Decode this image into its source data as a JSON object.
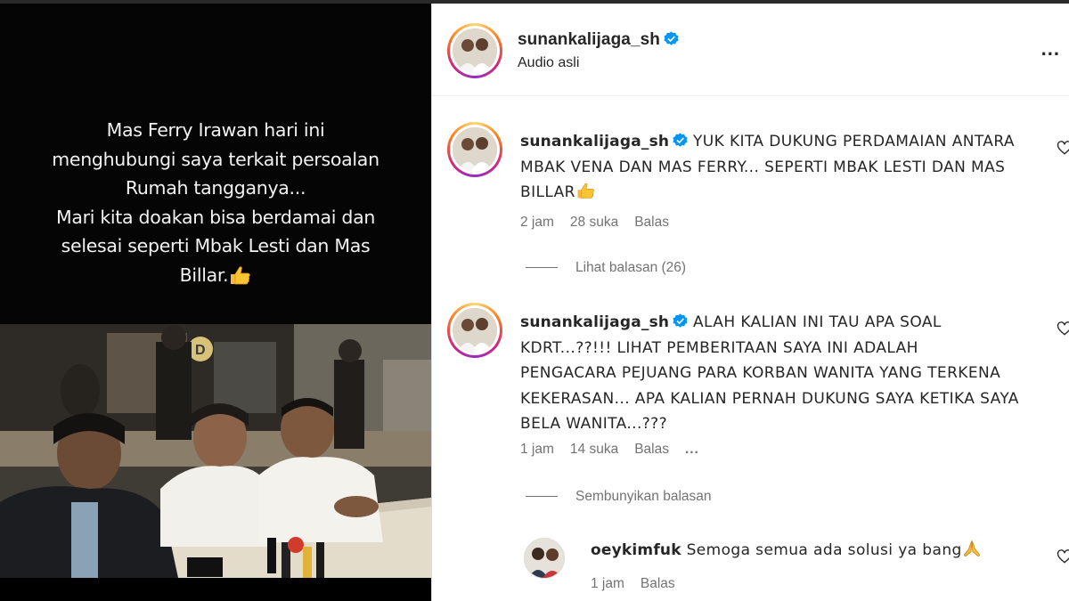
{
  "video": {
    "caption_lines": [
      "Mas Ferry Irawan hari ini",
      "menghubungi saya terkait persoalan",
      "Rumah tangganya...",
      "Mari kita doakan bisa berdamai dan",
      "selesai seperti Mbak Lesti dan Mas",
      "Billar."
    ]
  },
  "post": {
    "username": "sunankalijaga_sh",
    "subtitle": "Audio asli",
    "more": "..."
  },
  "comments": [
    {
      "username": "sunankalijaga_sh",
      "text": "YUK KITA DUKUNG PERDAMAIAN ANTARA MBAK VENA DAN MAS FERRY... SEPERTI MBAK LESTI DAN MAS BILLAR",
      "time": "2 jam",
      "likes": "28 suka",
      "reply": "Balas",
      "replies_toggle": "Lihat balasan (26)"
    },
    {
      "username": "sunankalijaga_sh",
      "text": "ALAH KALIAN INI TAU APA SOAL KDRT...??!!! LIHAT PEMBERITAAN SAYA INI ADALAH PENGACARA PEJUANG PARA KORBAN WANITA YANG TERKENA KEKERASAN... APA KALIAN PERNAH DUKUNG SAYA KETIKA SAYA BELA WANITA...???",
      "time": "1 jam",
      "likes": "14 suka",
      "reply": "Balas",
      "more": "...",
      "replies_toggle": "Sembunyikan balasan"
    }
  ],
  "reply": {
    "username": "oeykimfuk",
    "text": "Semoga semua ada solusi ya bang",
    "time": "1 jam",
    "reply": "Balas"
  },
  "icons": {
    "verified": "verified-badge-icon",
    "heart": "heart-outline-icon",
    "thumbs_up": "thumbs-up-emoji",
    "praying_hands": "praying-hands-emoji"
  },
  "colors": {
    "verified_blue": "#0095f6",
    "secondary_text": "#737373",
    "primary_text": "#262626"
  }
}
